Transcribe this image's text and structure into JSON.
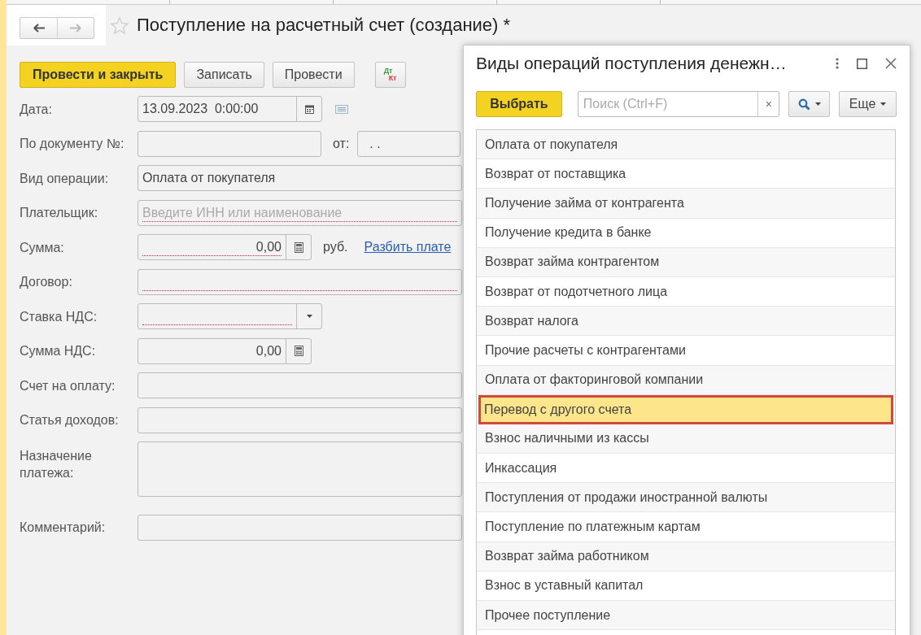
{
  "nav": {
    "back_enabled": true,
    "forward_enabled": false
  },
  "title": "Поступление на расчетный счет (создание) *",
  "favorite": false,
  "toolbar": [
    {
      "label": "Провести и закрыть",
      "kind": "primary"
    },
    {
      "label": "Записать",
      "kind": "normal"
    },
    {
      "label": "Провести",
      "kind": "normal"
    }
  ],
  "dt_kt": {
    "top": "Дт",
    "bottom": "Кт"
  },
  "fields": [
    {
      "label": "Дата:",
      "kind": "date",
      "value": "13.09.2023  0:00:00"
    },
    {
      "label": "По документу №:",
      "kind": "number_date",
      "date_label": "от:",
      "date_value": ". ."
    },
    {
      "label": "Вид операции:",
      "kind": "text",
      "value": "Оплата от покупателя",
      "required": false
    },
    {
      "label": "Плательщик:",
      "kind": "text",
      "placeholder": "Введите ИНН или наименование",
      "required": true
    },
    {
      "label": "Сумма:",
      "kind": "amount",
      "value": "0,00",
      "required": true,
      "unit": "руб.",
      "link": "Разбить плате"
    },
    {
      "label": "Договор:",
      "kind": "text",
      "required": true
    },
    {
      "label": "Ставка НДС:",
      "kind": "select",
      "required": true
    },
    {
      "label": "Сумма НДС:",
      "kind": "amount",
      "value": "0,00",
      "required": false
    },
    {
      "label": "Счет на оплату:",
      "kind": "text",
      "required": false
    },
    {
      "label": "Статья доходов:",
      "kind": "text",
      "required": false
    },
    {
      "label": "Назначение платежа:",
      "kind": "textarea"
    },
    {
      "label": "Комментарий:",
      "kind": "text",
      "required": false
    }
  ],
  "popup": {
    "title": "Виды операций поступления денежн…",
    "select_button": "Выбрать",
    "search": {
      "placeholder": "Поиск (Ctrl+F)",
      "clear": "×"
    },
    "more_button": "Еще",
    "items": [
      {
        "label": "Оплата от покупателя",
        "selected": false
      },
      {
        "label": "Возврат от поставщика",
        "selected": false
      },
      {
        "label": "Получение займа от контрагента",
        "selected": false
      },
      {
        "label": "Получение кредита в банке",
        "selected": false
      },
      {
        "label": "Возврат займа контрагентом",
        "selected": false
      },
      {
        "label": "Возврат от подотчетного лица",
        "selected": false
      },
      {
        "label": "Возврат налога",
        "selected": false
      },
      {
        "label": "Прочие расчеты с контрагентами",
        "selected": false
      },
      {
        "label": "Оплата от факторинговой компании",
        "selected": false
      },
      {
        "label": "Перевод с другого счета",
        "selected": true
      },
      {
        "label": "Взнос наличными из кассы",
        "selected": false
      },
      {
        "label": "Инкассация",
        "selected": false
      },
      {
        "label": "Поступления от продажи иностранной валюты",
        "selected": false
      },
      {
        "label": "Поступление по платежным картам",
        "selected": false
      },
      {
        "label": "Возврат займа работником",
        "selected": false
      },
      {
        "label": "Взнос в уставный капитал",
        "selected": false
      },
      {
        "label": "Прочее поступление",
        "selected": false
      }
    ]
  }
}
